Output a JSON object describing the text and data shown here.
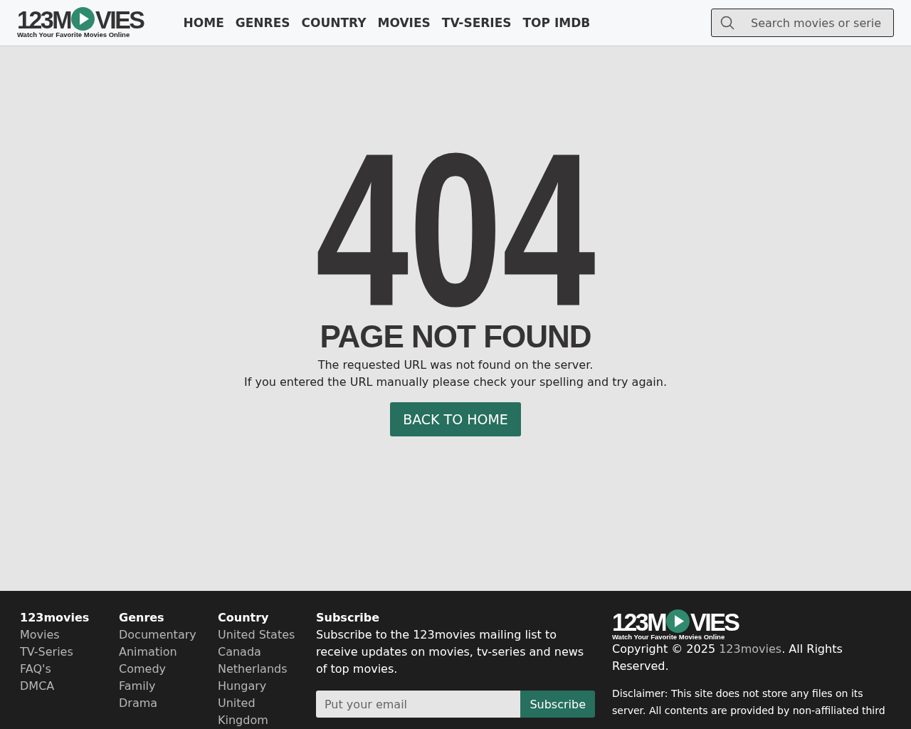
{
  "header": {
    "logo": {
      "lead": "123M",
      "trail": "VIES",
      "tagline": "Watch Your Favorite Movies Online"
    },
    "nav": [
      "HOME",
      "GENRES",
      "COUNTRY",
      "MOVIES",
      "TV-SERIES",
      "TOP IMDB"
    ],
    "search": {
      "placeholder": "Search movies or serie"
    }
  },
  "error": {
    "code": "404",
    "title": "PAGE NOT FOUND",
    "lines": [
      "The requested URL was not found on the server.",
      "If you entered the URL manually please check your spelling and try again."
    ],
    "button": "BACK TO HOME"
  },
  "footer": {
    "columns": [
      {
        "title": "123movies",
        "links": [
          "Movies",
          "TV-Series",
          "FAQ's",
          "DMCA"
        ]
      },
      {
        "title": "Genres",
        "links": [
          "Documentary",
          "Animation",
          "Comedy",
          "Family",
          "Drama"
        ]
      },
      {
        "title": "Country",
        "links": [
          "United States",
          "Canada",
          "Netherlands",
          "Hungary",
          "United Kingdom"
        ]
      }
    ],
    "subscribe": {
      "title": "Subscribe",
      "text": "Subscribe to the 123movies mailing list to receive updates on movies, tv-series and news of top movies.",
      "placeholder": "Put your email",
      "button": "Subscribe"
    },
    "logo": {
      "lead": "123M",
      "trail": "VIES",
      "tagline": "Watch Your Favorite Movies Online"
    },
    "copyright": {
      "before": "Copyright © 2025 ",
      "link": "123movies",
      "after": ". All Rights Reserved."
    },
    "disclaimer": "Disclaimer: This site does not store any files on its server. All contents are provided by non-affiliated third"
  }
}
